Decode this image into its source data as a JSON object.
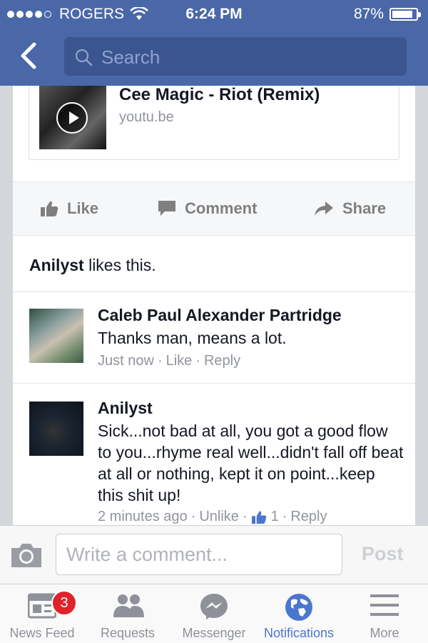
{
  "status_bar": {
    "carrier": "ROGERS",
    "time": "6:24 PM",
    "battery": "87%",
    "battery_level": 0.87
  },
  "search": {
    "placeholder": "Search"
  },
  "link_card": {
    "title": "Cee Magic - Riot (Remix)",
    "domain": "youtu.be"
  },
  "actions": {
    "like": "Like",
    "comment": "Comment",
    "share": "Share"
  },
  "likes": {
    "name": "Anilyst",
    "text": " likes this."
  },
  "comments": [
    {
      "name": "Caleb Paul Alexander Partridge",
      "text": "Thanks man, means a lot.",
      "time": "Just now",
      "like": "Like",
      "reply": "Reply"
    },
    {
      "name": "Anilyst",
      "text": "Sick...not bad at all, you got a good flow to you...rhyme real well...didn't fall off beat at all or nothing, kept it on point...keep this shit up!",
      "time": "2 minutes ago",
      "like": "Unlike",
      "like_count": "1",
      "reply": "Reply"
    }
  ],
  "composer": {
    "placeholder": "Write a comment...",
    "post": "Post"
  },
  "tabs": [
    {
      "label": "News Feed",
      "icon": "news-feed-icon",
      "badge": "3"
    },
    {
      "label": "Requests",
      "icon": "friend-requests-icon"
    },
    {
      "label": "Messenger",
      "icon": "messenger-icon"
    },
    {
      "label": "Notifications",
      "icon": "globe-icon",
      "active": true
    },
    {
      "label": "More",
      "icon": "menu-icon"
    }
  ],
  "colors": {
    "header": "#4a68a8",
    "accent": "#4a76d0",
    "badge": "#e0222b"
  }
}
